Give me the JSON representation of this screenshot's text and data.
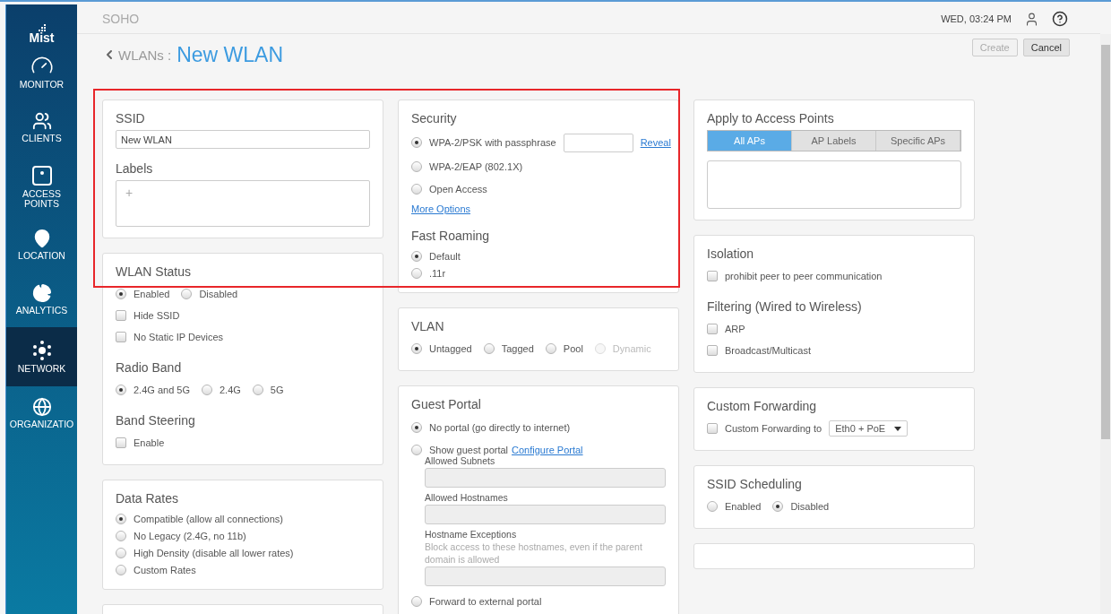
{
  "logo": "Mist",
  "sidebar": [
    {
      "label": "MONITOR",
      "selected": false
    },
    {
      "label": "CLIENTS",
      "selected": false
    },
    {
      "label": "ACCESS POINTS",
      "selected": false
    },
    {
      "label": "LOCATION",
      "selected": false
    },
    {
      "label": "ANALYTICS",
      "selected": false
    },
    {
      "label": "NETWORK",
      "selected": true
    },
    {
      "label": "ORGANIZATIO",
      "selected": false
    }
  ],
  "header": {
    "site": "SOHO",
    "datetime": "WED, 03:24 PM"
  },
  "breadcrumb": {
    "parent": "WLANs",
    "separator": ":",
    "title": "New WLAN"
  },
  "actions": [
    {
      "label": "Create",
      "disabled": true
    },
    {
      "label": "Cancel",
      "disabled": false
    }
  ],
  "columns": [
    [
      {
        "kind": "form",
        "blocks": [
          {
            "kind": "heading",
            "text": "SSID"
          },
          {
            "kind": "input",
            "value": "New WLAN"
          },
          {
            "kind": "heading",
            "text": "Labels"
          },
          {
            "kind": "labelbox",
            "text": "+"
          }
        ]
      },
      {
        "kind": "form",
        "blocks": [
          {
            "kind": "heading",
            "text": "WLAN Status"
          },
          {
            "kind": "radio_row",
            "options": [
              {
                "label": "Enabled",
                "selected": true
              },
              {
                "label": "Disabled",
                "selected": false
              }
            ]
          },
          {
            "kind": "checkbox",
            "label": "Hide SSID",
            "checked": false
          },
          {
            "kind": "checkbox",
            "label": "No Static IP Devices",
            "checked": false
          },
          {
            "kind": "heading",
            "text": "Radio Band"
          },
          {
            "kind": "radio_row",
            "options": [
              {
                "label": "2.4G and 5G",
                "selected": true
              },
              {
                "label": "2.4G",
                "selected": false
              },
              {
                "label": "5G",
                "selected": false
              }
            ]
          },
          {
            "kind": "heading",
            "text": "Band Steering"
          },
          {
            "kind": "checkbox",
            "label": "Enable",
            "checked": false
          }
        ]
      },
      {
        "kind": "form",
        "blocks": [
          {
            "kind": "heading",
            "text": "Data Rates"
          },
          {
            "kind": "radio_list",
            "options": [
              {
                "label": "Compatible (allow all connections)",
                "selected": true
              },
              {
                "label": "No Legacy (2.4G, no 11b)",
                "selected": false
              },
              {
                "label": "High Density (disable all lower rates)",
                "selected": false
              },
              {
                "label": "Custom Rates",
                "selected": false
              }
            ]
          }
        ]
      },
      {
        "kind": "blank"
      }
    ],
    [
      {
        "kind": "form",
        "blocks": [
          {
            "kind": "heading",
            "text": "Security"
          },
          {
            "kind": "radio_passphrase",
            "label": "WPA-2/PSK with passphrase",
            "selected": true,
            "link": "Reveal"
          },
          {
            "kind": "radio",
            "label": "WPA-2/EAP (802.1X)",
            "selected": false
          },
          {
            "kind": "radio",
            "label": "Open Access",
            "selected": false
          },
          {
            "kind": "link",
            "text": "More Options"
          },
          {
            "kind": "heading",
            "text": "Fast Roaming"
          },
          {
            "kind": "radio_list",
            "options": [
              {
                "label": "Default",
                "selected": true
              },
              {
                "label": ".11r",
                "selected": false
              }
            ]
          }
        ]
      },
      {
        "kind": "form",
        "blocks": [
          {
            "kind": "heading",
            "text": "VLAN"
          },
          {
            "kind": "radio_row",
            "options": [
              {
                "label": "Untagged",
                "selected": true
              },
              {
                "label": "Tagged",
                "selected": false
              },
              {
                "label": "Pool",
                "selected": false
              },
              {
                "label": "Dynamic",
                "selected": false,
                "disabled": true
              }
            ]
          }
        ]
      },
      {
        "kind": "form",
        "blocks": [
          {
            "kind": "heading",
            "text": "Guest Portal"
          },
          {
            "kind": "radio",
            "label": "No portal (go directly to internet)",
            "selected": true
          },
          {
            "kind": "radio",
            "label": "Show guest portal",
            "selected": false,
            "link": "Configure Portal"
          },
          {
            "kind": "subfields",
            "fields": [
              {
                "label": "Allowed Subnets"
              },
              {
                "label": "Allowed Hostnames"
              },
              {
                "label": "Hostname Exceptions",
                "hint": "Block access to these hostnames, even if the parent domain is allowed"
              }
            ]
          },
          {
            "kind": "radio",
            "label": "Forward to external portal",
            "selected": false
          }
        ]
      }
    ],
    [
      {
        "kind": "form",
        "blocks": [
          {
            "kind": "heading",
            "text": "Apply to Access Points"
          },
          {
            "kind": "segments",
            "options": [
              {
                "label": "All APs",
                "selected": true
              },
              {
                "label": "AP Labels",
                "selected": false
              },
              {
                "label": "Specific APs",
                "selected": false
              }
            ]
          },
          {
            "kind": "box"
          }
        ]
      },
      {
        "kind": "form",
        "blocks": [
          {
            "kind": "heading",
            "text": "Isolation"
          },
          {
            "kind": "checkbox",
            "label": "prohibit peer to peer communication",
            "checked": false
          },
          {
            "kind": "heading",
            "text": "Filtering (Wired to Wireless)"
          },
          {
            "kind": "checkbox",
            "label": "ARP",
            "checked": false
          },
          {
            "kind": "checkbox",
            "label": "Broadcast/Multicast",
            "checked": false
          }
        ]
      },
      {
        "kind": "form",
        "blocks": [
          {
            "kind": "heading",
            "text": "Custom Forwarding"
          },
          {
            "kind": "checkbox",
            "label": "Custom Forwarding to",
            "checked": false,
            "select": "Eth0 + PoE"
          }
        ]
      },
      {
        "kind": "form",
        "blocks": [
          {
            "kind": "heading",
            "text": "SSID Scheduling"
          },
          {
            "kind": "radio_row",
            "options": [
              {
                "label": "Enabled",
                "selected": false
              },
              {
                "label": "Disabled",
                "selected": true
              }
            ]
          }
        ]
      },
      {
        "kind": "blank"
      }
    ]
  ]
}
